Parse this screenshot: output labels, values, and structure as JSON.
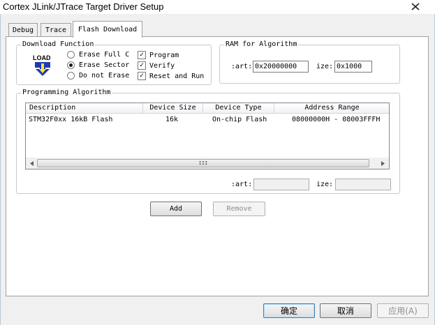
{
  "window": {
    "title": "Cortex JLink/JTrace Target Driver Setup",
    "close_glyph": "✕"
  },
  "tabs": [
    {
      "label": "Debug"
    },
    {
      "label": "Trace"
    },
    {
      "label": "Flash Download"
    }
  ],
  "download_function": {
    "legend": "Download Function",
    "icon_text": "LOAD",
    "radios": [
      {
        "label": "Erase Full C",
        "selected": false
      },
      {
        "label": "Erase Sector",
        "selected": true
      },
      {
        "label": "Do not Erase",
        "selected": false
      }
    ],
    "checks": [
      {
        "label": "Program",
        "checked": true
      },
      {
        "label": "Verify",
        "checked": true
      },
      {
        "label": "Reset and Run",
        "checked": true
      }
    ]
  },
  "ram": {
    "legend": "RAM for Algorithm",
    "start_label": ":art:",
    "start_value": "0x20000000",
    "size_label": "ize:",
    "size_value": "0x1000"
  },
  "programming": {
    "legend": "Programming Algorithm",
    "columns": [
      "Description",
      "Device Size",
      "Device Type",
      "Address Range"
    ],
    "rows": [
      {
        "description": "STM32F0xx 16kB Flash",
        "size": "16k",
        "type": "On-chip Flash",
        "range": "08000000H - 08003FFFH"
      }
    ],
    "start_label": ":art:",
    "start_value": "",
    "size_label": "ize:",
    "size_value": "",
    "scroll_grip": "III"
  },
  "buttons": {
    "add": "Add",
    "remove": "Remove",
    "ok": "确定",
    "cancel": "取消",
    "apply": "应用(A)"
  }
}
